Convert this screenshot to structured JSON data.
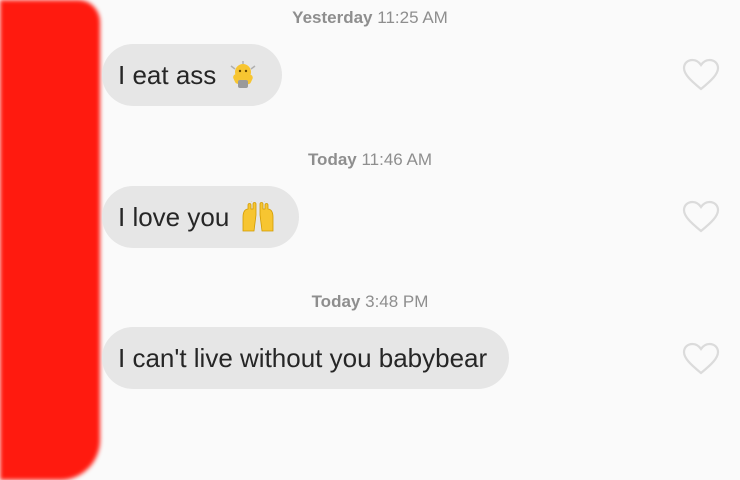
{
  "thread": {
    "messages": [
      {
        "day": "Yesterday",
        "time": "11:25 AM",
        "text": "I eat ass",
        "emoji": "dancing-hands-emoji"
      },
      {
        "day": "Today",
        "time": "11:46 AM",
        "text": "I love you",
        "emoji": "raising-hands-emoji"
      },
      {
        "day": "Today",
        "time": "3:48 PM",
        "text": "I can't live without you babybear",
        "emoji": ""
      }
    ]
  },
  "colors": {
    "background": "#fafafa",
    "bubble": "#e6e6e6",
    "text": "#262626",
    "timestamp": "#8e8e8e",
    "redaction": "#ff1a0f",
    "heart_outline": "#dbdbdb",
    "emoji_yellow": "#f7c531"
  },
  "icons": {
    "like": "heart-outline-icon"
  }
}
